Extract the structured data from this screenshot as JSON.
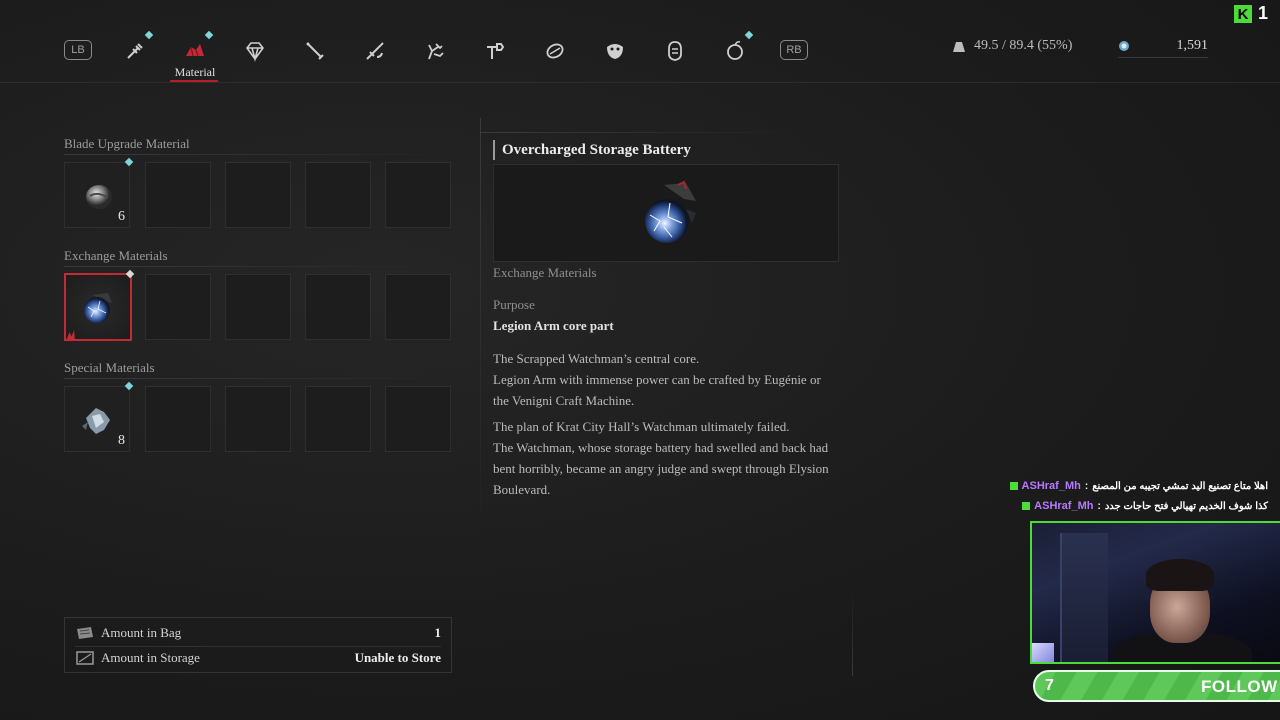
{
  "topbar": {
    "lb_label": "LB",
    "rb_label": "RB",
    "tabs": [
      {
        "name": "syringe",
        "has_new": true
      },
      {
        "name": "material",
        "label": "Material",
        "has_new": true,
        "active": true
      },
      {
        "name": "gem"
      },
      {
        "name": "blade"
      },
      {
        "name": "handle"
      },
      {
        "name": "legion-arm"
      },
      {
        "name": "wrench"
      },
      {
        "name": "amulet"
      },
      {
        "name": "mask"
      },
      {
        "name": "head"
      },
      {
        "name": "fruit",
        "has_new": true
      }
    ],
    "weight": "49.5 / 89.4 (55%)",
    "ergo": "1,591"
  },
  "inventory": {
    "sections": [
      {
        "title": "Blade Upgrade Material",
        "slots": [
          {
            "filled": true,
            "qty": "6",
            "icon": "moonstone-icon",
            "new": true
          },
          {},
          {},
          {},
          {}
        ]
      },
      {
        "title": "Exchange Materials",
        "slots": [
          {
            "filled": true,
            "icon": "storage-battery-icon",
            "selected": true,
            "new": true
          },
          {},
          {},
          {},
          {}
        ]
      },
      {
        "title": "Special Materials",
        "slots": [
          {
            "filled": true,
            "qty": "8",
            "icon": "star-fragment-icon",
            "new": true
          },
          {},
          {},
          {},
          {}
        ]
      }
    ]
  },
  "detail": {
    "title": "Overcharged Storage Battery",
    "category": "Exchange Materials",
    "purpose_label": "Purpose",
    "purpose_value": "Legion Arm core part",
    "desc1": [
      "The Scrapped Watchman’s central core.",
      "Legion Arm with immense power can be crafted by Eugénie or",
      "the Venigni Craft Machine."
    ],
    "desc2": [
      "The plan of Krat City Hall’s Watchman ultimately failed.",
      "The Watchman, whose storage battery had swelled and back had",
      "bent horribly, became an angry judge and swept through Elysion",
      "Boulevard."
    ]
  },
  "info": {
    "bag_label": "Amount in Bag",
    "bag_value": "1",
    "storage_label": "Amount in Storage",
    "storage_value": "Unable to Store"
  },
  "stream": {
    "kick_count": "1",
    "chat": [
      {
        "user": "ASHraf_Mh",
        "message": "اهلا متاع تصنيع اليد تمشي تجيبه من المصنع"
      },
      {
        "user": "ASHraf_Mh",
        "message": "كذا شوف الخديم تهيالي فتح حاجات جدد"
      }
    ],
    "follow_count": "7",
    "follow_label": "FOLLOW"
  },
  "colors": {
    "accent_red": "#c22b35",
    "new_marker": "#7fd6d6",
    "kick_green": "#4ddb3a"
  }
}
